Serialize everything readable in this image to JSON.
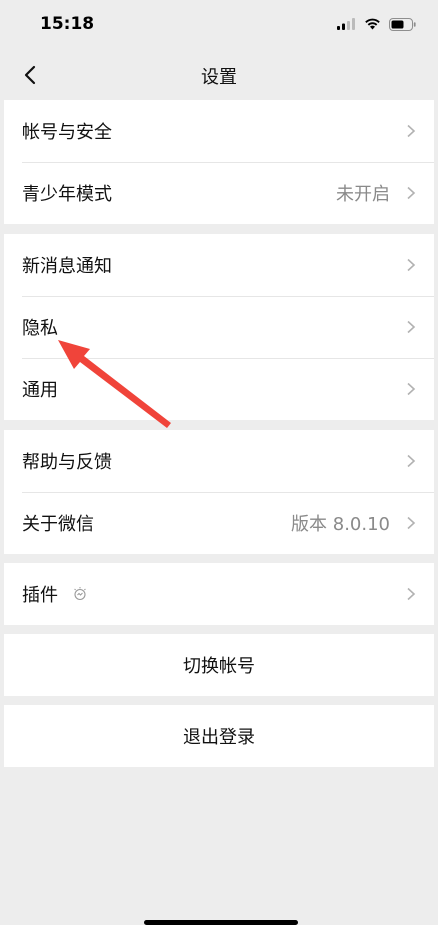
{
  "status_bar": {
    "time": "15:18"
  },
  "nav": {
    "title": "设置"
  },
  "group1": [
    {
      "label": "帐号与安全",
      "value": ""
    },
    {
      "label": "青少年模式",
      "value": "未开启"
    }
  ],
  "group2": [
    {
      "label": "新消息通知",
      "value": ""
    },
    {
      "label": "隐私",
      "value": ""
    },
    {
      "label": "通用",
      "value": ""
    }
  ],
  "group3": [
    {
      "label": "帮助与反馈",
      "value": ""
    },
    {
      "label": "关于微信",
      "value": "版本 8.0.10"
    }
  ],
  "group4": [
    {
      "label": "插件",
      "value": ""
    }
  ],
  "actions": {
    "switch_account": "切换帐号",
    "logout": "退出登录"
  },
  "colors": {
    "background": "#ededed",
    "card": "#ffffff",
    "annotation": "#f0443a"
  }
}
